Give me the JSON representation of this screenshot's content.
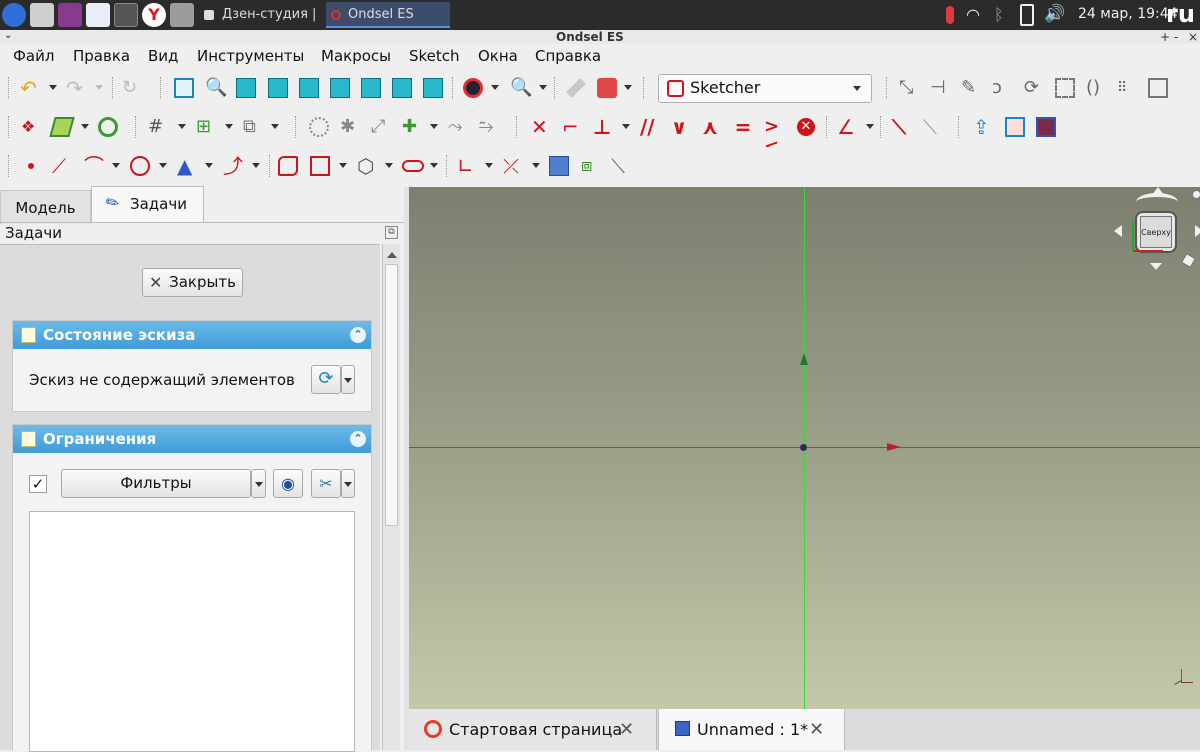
{
  "taskbar": {
    "tasks": [
      {
        "label": "Дзен-студия | ..."
      },
      {
        "label": "Ondsel ES"
      }
    ],
    "clock": "24 мар, 19:44",
    "keyboard_layout": "ru",
    "icons": [
      "start-menu-icon",
      "camera-icon",
      "media-player-icon",
      "text-editor-icon",
      "calculator-icon",
      "yandex-browser-icon",
      "file-manager-icon",
      "temperature-icon",
      "wifi-icon",
      "bluetooth-icon",
      "battery-icon",
      "volume-icon"
    ]
  },
  "window": {
    "title": "Ondsel ES",
    "controls": {
      "minimize": "+",
      "restore": "-",
      "close": "×"
    }
  },
  "menubar": {
    "items": [
      "Файл",
      "Правка",
      "Вид",
      "Инструменты",
      "Макросы",
      "Sketch",
      "Окна",
      "Справка"
    ]
  },
  "toolbar": {
    "workbench": "Sketcher",
    "accent_red": "#d0141c",
    "accent_cyan": "#1fb5c9"
  },
  "left_panel": {
    "tabs": [
      "Модель",
      "Задачи"
    ],
    "active_tab": "Задачи",
    "title": "Задачи",
    "close_button": "Закрыть",
    "sketch_state": {
      "header": "Состояние эскиза",
      "message": "Эскиз не содержащий элементов"
    },
    "constraints": {
      "header": "Ограничения",
      "filters_label": "Фильтры",
      "checkbox_checked": true
    }
  },
  "navigation_cube": {
    "face_label": "Сверху"
  },
  "viewport": {
    "background_top": "#7c7f6f",
    "background_bottom": "#c3c9a8",
    "x_axis_color": "#c83232",
    "y_axis_color": "#33dd33"
  },
  "bottom_tabs": [
    {
      "label": "Стартовая страница"
    },
    {
      "label": "Unnamed : 1*"
    }
  ]
}
